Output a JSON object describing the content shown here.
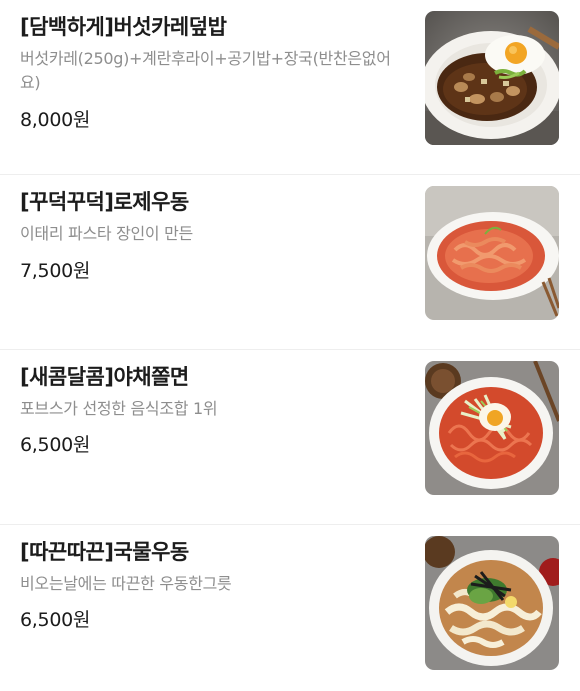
{
  "menu": {
    "items": [
      {
        "name": "[담백하게]버섯카레덮밥",
        "description": "버섯카레(250g)+계란후라이+공기밥+장국(반찬은없어요)",
        "price": "8,000원",
        "image_icon": "mushroom-curry-rice-photo"
      },
      {
        "name": "[꾸덕꾸덕]로제우동",
        "description": "이태리 파스타 장인이 만든",
        "price": "7,500원",
        "image_icon": "rose-udon-photo"
      },
      {
        "name": "[새콤달콤]야채쫄면",
        "description": "포브스가 선정한 음식조합 1위",
        "price": "6,500원",
        "image_icon": "vegetable-jjolmyeon-photo"
      },
      {
        "name": "[따끈따끈]국물우동",
        "description": "비오는날에는 따끈한 우동한그릇",
        "price": "6,500원",
        "image_icon": "broth-udon-photo"
      }
    ]
  }
}
